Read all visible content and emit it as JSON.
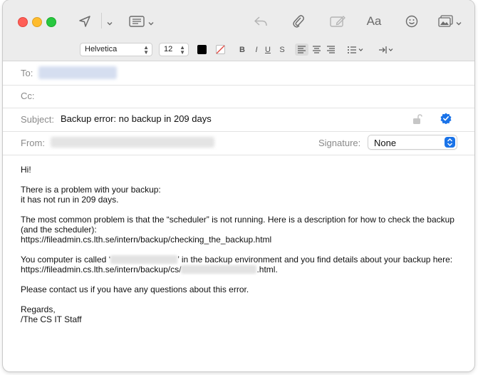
{
  "toolbar": {
    "send_icon": "paper-plane-icon",
    "header_fields_icon": "list-icon",
    "reply_icon": "reply-icon",
    "attach_icon": "paperclip-icon",
    "markup_icon": "markup-icon",
    "format_label": "Aa",
    "emoji_icon": "smiley-icon",
    "photo_icon": "photo-icon"
  },
  "format_bar": {
    "font": "Helvetica",
    "size": "12",
    "bold": "B",
    "italic": "I",
    "underline": "U",
    "strike": "S"
  },
  "headers": {
    "to_label": "To:",
    "cc_label": "Cc:",
    "subject_label": "Subject:",
    "subject_value": "Backup error: no backup in 209 days",
    "from_label": "From:",
    "signature_label": "Signature:",
    "signature_value": "None"
  },
  "body": {
    "greeting": "Hi!",
    "line1": "There is a problem with your backup:",
    "line2": "it has not run in 209 days.",
    "para2": "The most common problem is that the “scheduler” is not running. Here is a description for how to check the backup (and the scheduler):",
    "link1": "https://fileadmin.cs.lth.se/intern/backup/checking_the_backup.html",
    "para3_start": "You computer is called ‘",
    "para3_end": "’ in the backup environment and you find details about your backup here:",
    "link2_start": "https://fileadmin.cs.lth.se/intern/backup/cs/",
    "link2_end": ".html.",
    "para4": "Please contact us if you have any questions about this error.",
    "closing": "Regards,",
    "signoff": "/The CS IT Staff"
  },
  "colors": {
    "close": "#ff5f57",
    "minimize": "#febc2e",
    "zoom": "#28c840",
    "accent": "#1a73e8"
  }
}
